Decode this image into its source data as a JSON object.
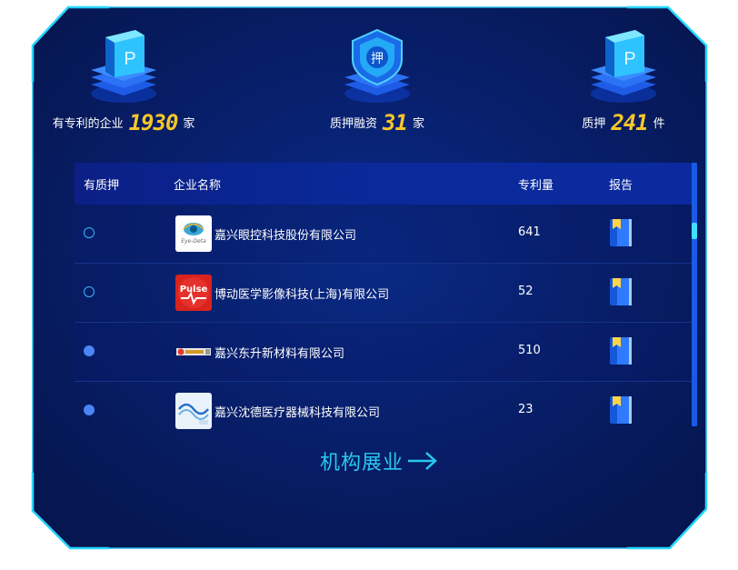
{
  "stats": [
    {
      "label": "有专利的企业",
      "value": "1930",
      "unit": "家",
      "icon": "patent-cube-icon"
    },
    {
      "label": "质押融资",
      "value": "31",
      "unit": "家",
      "icon": "pledge-shield-icon"
    },
    {
      "label": "质押",
      "value": "241",
      "unit": "件",
      "icon": "patent-cube-icon"
    }
  ],
  "pledge_shield_char": "押",
  "table": {
    "headers": {
      "pledge": "有质押",
      "name": "企业名称",
      "count": "专利量",
      "report": "报告"
    },
    "rows": [
      {
        "pledged": false,
        "logo": "eye-logo",
        "name": "嘉兴眼控科技股份有限公司",
        "count": "641",
        "logo_text": "Eye-Deta"
      },
      {
        "pledged": false,
        "logo": "pulse-logo",
        "name": "博动医学影像科技(上海)有限公司",
        "count": "52",
        "logo_text": "Pulse"
      },
      {
        "pledged": true,
        "logo": "dongsheng-logo",
        "name": "嘉兴东升新材料有限公司",
        "count": "510",
        "logo_text": ""
      },
      {
        "pledged": true,
        "logo": "shende-logo",
        "name": "嘉兴沈德医疗器械科技有限公司",
        "count": "23",
        "logo_text": ""
      }
    ]
  },
  "expand_label": "机构展业",
  "colors": {
    "accent": "#f6c62a",
    "cyan": "#28c8f0",
    "panel": "#081c63"
  }
}
